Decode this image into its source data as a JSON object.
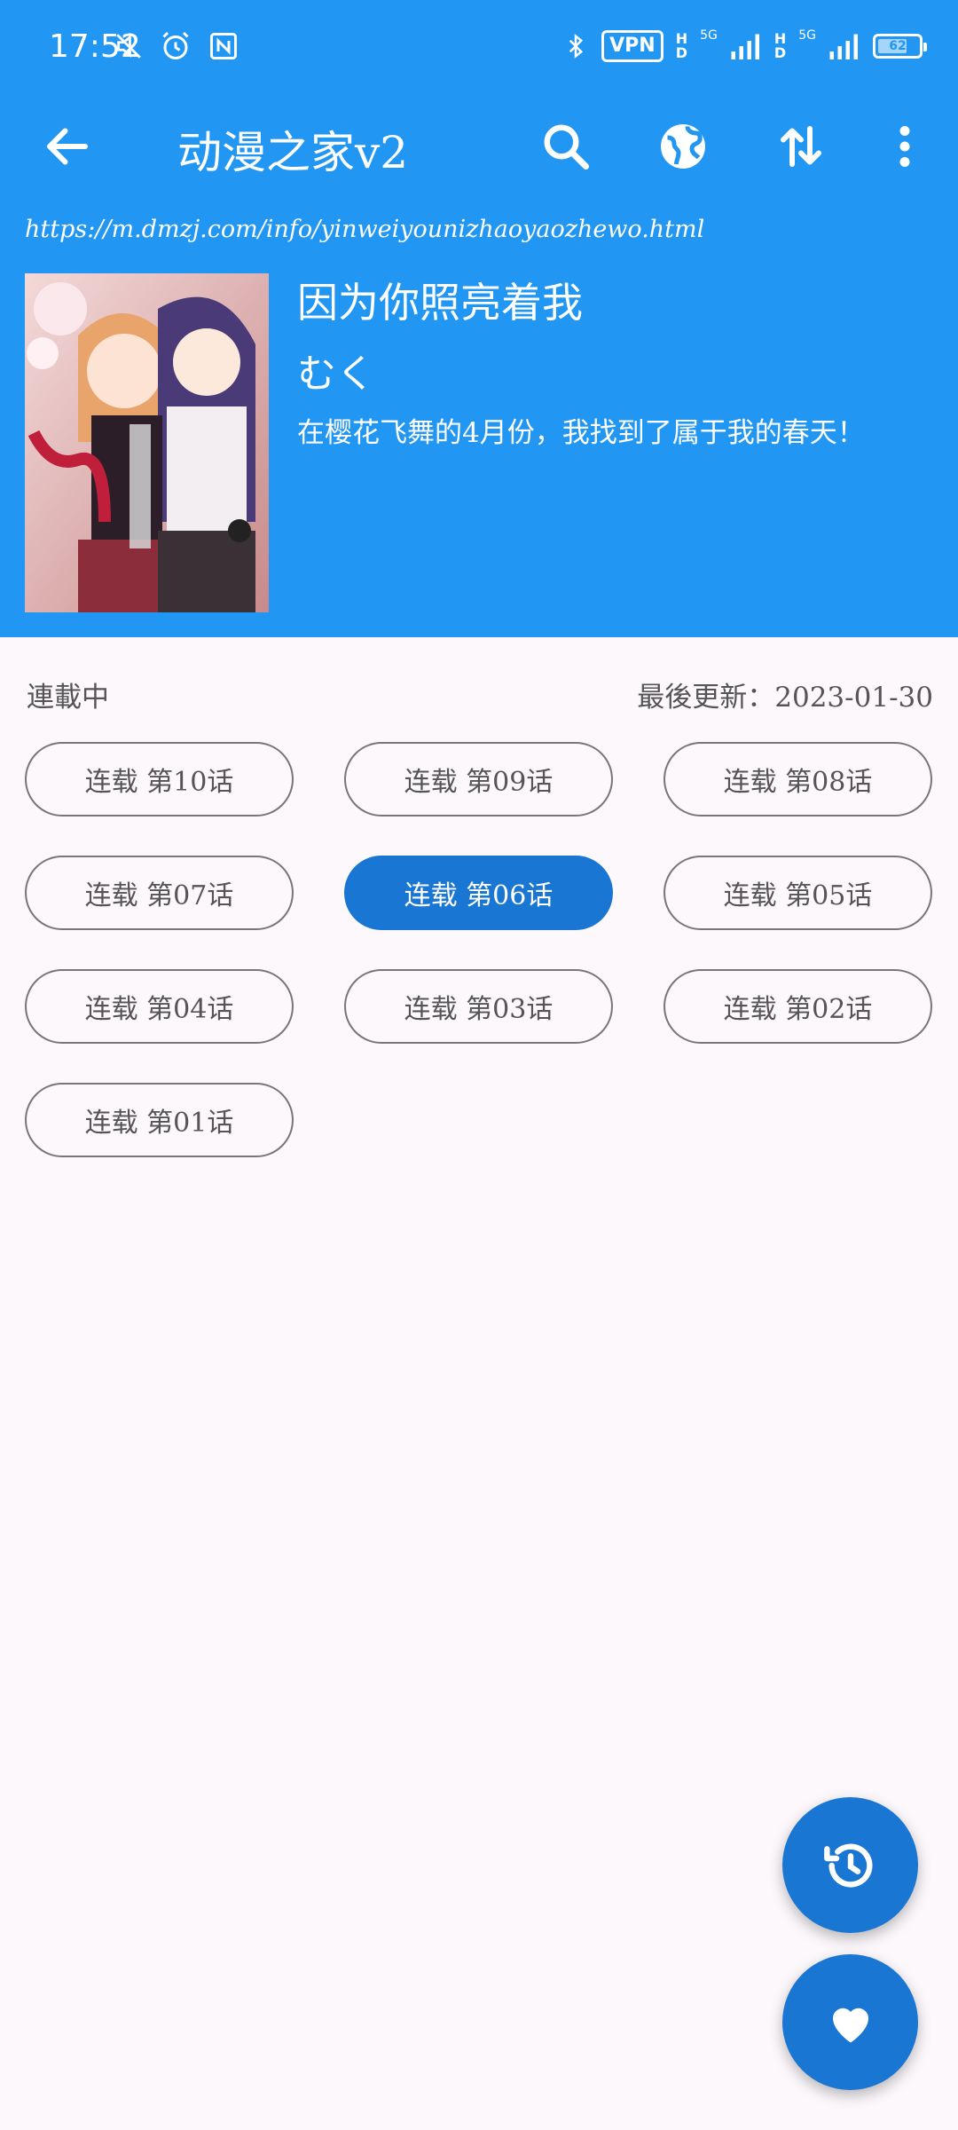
{
  "status_bar": {
    "time": "17:52",
    "vpn_label": "VPN",
    "signal_1": "5G",
    "signal_2": "5G",
    "hd_label": "HD",
    "battery_level": "62",
    "icons": [
      "mute-icon",
      "alarm-icon",
      "nfc-icon",
      "bluetooth-icon",
      "signal-icon",
      "battery-icon"
    ]
  },
  "toolbar": {
    "title": "动漫之家v2",
    "icons": [
      "back-arrow-icon",
      "search-icon",
      "globe-icon",
      "sort-icon",
      "more-vert-icon"
    ]
  },
  "manga": {
    "url": "https://m.dmzj.com/info/yinweiyounizhaoyaozhewo.html",
    "title": "因为你照亮着我",
    "author": "むく",
    "description": "在樱花飞舞的4月份，我找到了属于我的春天！",
    "status": "連載中",
    "last_update": "最後更新：2023-01-30"
  },
  "chapters": [
    {
      "label": "连载 第10话",
      "selected": false
    },
    {
      "label": "连载 第09话",
      "selected": false
    },
    {
      "label": "连载 第08话",
      "selected": false
    },
    {
      "label": "连载 第07话",
      "selected": false
    },
    {
      "label": "连载 第06话",
      "selected": true
    },
    {
      "label": "连载 第05话",
      "selected": false
    },
    {
      "label": "连载 第04话",
      "selected": false
    },
    {
      "label": "连载 第03话",
      "selected": false
    },
    {
      "label": "连载 第02话",
      "selected": false
    },
    {
      "label": "连载 第01话",
      "selected": false
    }
  ],
  "fabs": [
    "history-icon",
    "favorite-heart-icon"
  ],
  "colors": {
    "primary": "#2196F3",
    "accent": "#1976D2",
    "background": "#FCF8FC"
  }
}
